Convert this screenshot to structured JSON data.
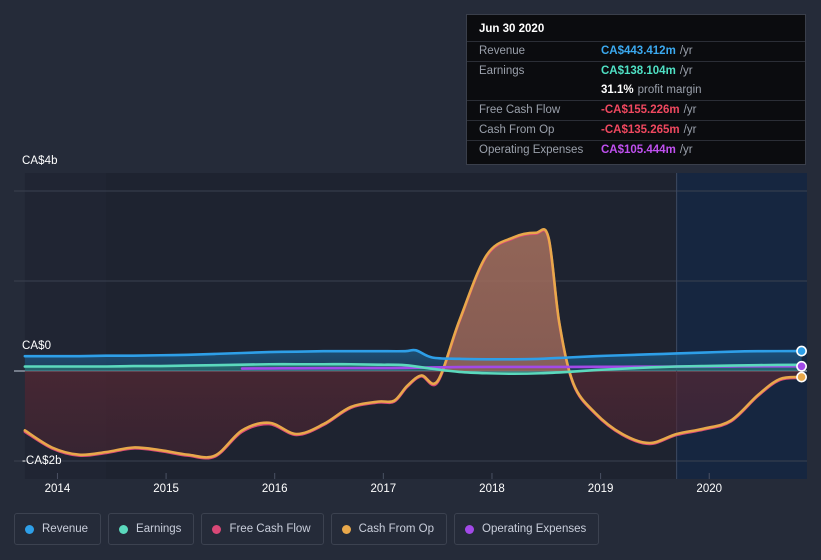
{
  "tooltip": {
    "title": "Jun 30 2020",
    "rows": [
      {
        "label": "Revenue",
        "value": "CA$443.412m",
        "unit": "/yr",
        "color": "#3ba9ef"
      },
      {
        "label": "Earnings",
        "value": "CA$138.104m",
        "unit": "/yr",
        "color": "#4fe0c4"
      },
      {
        "label": "",
        "value": "31.1%",
        "unit": "profit margin",
        "color": "#ffffff"
      },
      {
        "label": "Free Cash Flow",
        "value": "-CA$155.226m",
        "unit": "/yr",
        "color": "#f0485f"
      },
      {
        "label": "Cash From Op",
        "value": "-CA$135.265m",
        "unit": "/yr",
        "color": "#f0485f"
      },
      {
        "label": "Operating Expenses",
        "value": "CA$105.444m",
        "unit": "/yr",
        "color": "#c050f0"
      }
    ]
  },
  "legend": {
    "items": [
      {
        "label": "Revenue",
        "color": "#2e9fe8"
      },
      {
        "label": "Earnings",
        "color": "#5bd9bd"
      },
      {
        "label": "Free Cash Flow",
        "color": "#d94877"
      },
      {
        "label": "Cash From Op",
        "color": "#e8a84b"
      },
      {
        "label": "Operating Expenses",
        "color": "#a249e8"
      }
    ]
  },
  "axis": {
    "y_top_label": "CA$4b",
    "y_zero_label": "CA$0",
    "y_bottom_label": "-CA$2b",
    "x_ticks": [
      "2014",
      "2015",
      "2016",
      "2017",
      "2018",
      "2019",
      "2020"
    ]
  },
  "chart_data": {
    "type": "area",
    "title": "",
    "xlabel": "",
    "ylabel": "CA$",
    "ylim": [
      -2.4,
      4.4
    ],
    "yticks": [
      4,
      2,
      0,
      -2
    ],
    "ytick_labels": [
      "CA$4b",
      "",
      "CA$0",
      "-CA$2b"
    ],
    "grid": true,
    "legend_position": "bottom",
    "x_range": [
      "2013.6",
      "2020.9"
    ],
    "x_ticks": [
      2014,
      2015,
      2016,
      2017,
      2018,
      2019,
      2020
    ],
    "units": "CA$ billions",
    "forecast_divider_x": 2019.7,
    "series": [
      {
        "name": "Revenue",
        "color": "#2e9fe8",
        "x": [
          2013.7,
          2013.95,
          2014.2,
          2014.45,
          2014.7,
          2014.95,
          2015.2,
          2015.45,
          2015.7,
          2015.95,
          2016.2,
          2016.45,
          2016.7,
          2016.95,
          2017.2,
          2017.3,
          2017.45,
          2017.7,
          2017.95,
          2018.2,
          2018.45,
          2018.7,
          2018.95,
          2019.2,
          2019.45,
          2019.7,
          2019.95,
          2020.2,
          2020.45,
          2020.85
        ],
        "values": [
          0.33,
          0.33,
          0.33,
          0.34,
          0.34,
          0.35,
          0.36,
          0.38,
          0.4,
          0.42,
          0.43,
          0.44,
          0.44,
          0.44,
          0.44,
          0.46,
          0.3,
          0.27,
          0.26,
          0.26,
          0.27,
          0.3,
          0.33,
          0.35,
          0.37,
          0.39,
          0.41,
          0.43,
          0.44,
          0.443
        ]
      },
      {
        "name": "Earnings",
        "color": "#5bd9bd",
        "x": [
          2013.7,
          2013.95,
          2014.2,
          2014.45,
          2014.7,
          2014.95,
          2015.2,
          2015.45,
          2015.7,
          2015.95,
          2016.2,
          2016.45,
          2016.7,
          2016.95,
          2017.2,
          2017.45,
          2017.7,
          2017.95,
          2018.2,
          2018.45,
          2018.7,
          2018.95,
          2019.2,
          2019.45,
          2019.7,
          2019.95,
          2020.2,
          2020.45,
          2020.85
        ],
        "values": [
          0.1,
          0.1,
          0.1,
          0.1,
          0.11,
          0.11,
          0.12,
          0.13,
          0.14,
          0.15,
          0.15,
          0.15,
          0.15,
          0.14,
          0.13,
          0.05,
          -0.02,
          -0.05,
          -0.06,
          -0.05,
          -0.02,
          0.02,
          0.05,
          0.08,
          0.1,
          0.11,
          0.12,
          0.13,
          0.138
        ]
      },
      {
        "name": "Free Cash Flow",
        "color": "#d94877",
        "x": [
          2013.7,
          2013.95,
          2014.2,
          2014.45,
          2014.7,
          2014.95,
          2015.2,
          2015.45,
          2015.7,
          2015.95,
          2016.2,
          2016.45,
          2016.7,
          2016.95,
          2017.1,
          2017.22,
          2017.35,
          2017.5,
          2017.7,
          2017.95,
          2018.2,
          2018.4,
          2018.52,
          2018.62,
          2018.75,
          2018.95,
          2019.2,
          2019.45,
          2019.7,
          2019.95,
          2020.2,
          2020.45,
          2020.65,
          2020.85
        ],
        "values": [
          -1.35,
          -1.72,
          -1.88,
          -1.82,
          -1.72,
          -1.78,
          -1.88,
          -1.9,
          -1.35,
          -1.18,
          -1.42,
          -1.2,
          -0.82,
          -0.7,
          -0.68,
          -0.35,
          -0.12,
          -0.25,
          1.1,
          2.55,
          2.95,
          3.05,
          2.95,
          1.05,
          -0.3,
          -0.95,
          -1.42,
          -1.62,
          -1.42,
          -1.3,
          -1.12,
          -0.55,
          -0.2,
          -0.155
        ]
      },
      {
        "name": "Cash From Op",
        "color": "#e8a84b",
        "x": [
          2013.7,
          2013.95,
          2014.2,
          2014.45,
          2014.7,
          2014.95,
          2015.2,
          2015.45,
          2015.7,
          2015.95,
          2016.2,
          2016.45,
          2016.7,
          2016.95,
          2017.1,
          2017.22,
          2017.35,
          2017.5,
          2017.7,
          2017.95,
          2018.2,
          2018.4,
          2018.52,
          2018.62,
          2018.75,
          2018.95,
          2019.2,
          2019.45,
          2019.7,
          2019.95,
          2020.2,
          2020.45,
          2020.65,
          2020.85
        ],
        "values": [
          -1.32,
          -1.7,
          -1.86,
          -1.8,
          -1.7,
          -1.76,
          -1.86,
          -1.88,
          -1.32,
          -1.15,
          -1.4,
          -1.18,
          -0.8,
          -0.68,
          -0.66,
          -0.33,
          -0.1,
          -0.22,
          1.12,
          2.57,
          2.97,
          3.07,
          2.97,
          1.07,
          -0.28,
          -0.93,
          -1.4,
          -1.6,
          -1.4,
          -1.28,
          -1.1,
          -0.53,
          -0.18,
          -0.135
        ]
      },
      {
        "name": "Operating Expenses",
        "color": "#a249e8",
        "x": [
          2015.7,
          2015.95,
          2016.2,
          2016.45,
          2016.7,
          2016.95,
          2017.2,
          2017.45,
          2017.7,
          2017.95,
          2018.2,
          2018.45,
          2018.7,
          2018.95,
          2019.2,
          2019.45,
          2019.7,
          2019.95,
          2020.2,
          2020.45,
          2020.85
        ],
        "values": [
          0.055,
          0.058,
          0.06,
          0.062,
          0.064,
          0.066,
          0.068,
          0.08,
          0.088,
          0.09,
          0.09,
          0.09,
          0.09,
          0.092,
          0.094,
          0.096,
          0.098,
          0.1,
          0.102,
          0.104,
          0.105
        ]
      }
    ]
  }
}
